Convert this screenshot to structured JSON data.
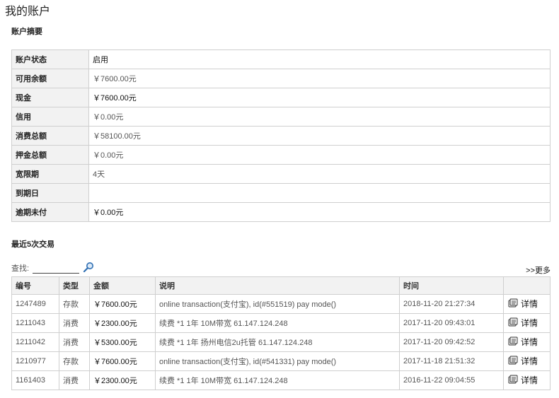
{
  "page_title": "我的账户",
  "summary": {
    "title": "账户摘要",
    "rows": [
      {
        "label": "账户状态",
        "value": "启用"
      },
      {
        "label": "可用余额",
        "value": "￥7600.00元"
      },
      {
        "label": "现金",
        "value": "￥7600.00元"
      },
      {
        "label": "信用",
        "value": "￥0.00元"
      },
      {
        "label": "消费总额",
        "value": "￥58100.00元"
      },
      {
        "label": "押金总额",
        "value": "￥0.00元"
      },
      {
        "label": "宽限期",
        "value": "4天"
      },
      {
        "label": "到期日",
        "value": ""
      },
      {
        "label": "逾期未付",
        "value": "￥0.00元"
      }
    ]
  },
  "transactions": {
    "title": "最近5次交易",
    "search_label": "查找:",
    "search_value": "",
    "more_label": ">>更多",
    "columns": [
      "编号",
      "类型",
      "金额",
      "说明",
      "时间",
      ""
    ],
    "rows": [
      {
        "id": "1247489",
        "type": "存款",
        "amount": "￥7600.00元",
        "description": "online transaction(支付宝), id(#551519) pay mode()",
        "time": "2018-11-20 21:27:34",
        "action": "详情"
      },
      {
        "id": "1211043",
        "type": "消费",
        "amount": "￥2300.00元",
        "description": "续费 *1 1年 10M带宽 61.147.124.248",
        "time": "2017-11-20 09:43:01",
        "action": "详情"
      },
      {
        "id": "1211042",
        "type": "消费",
        "amount": "￥5300.00元",
        "description": "续费 *1 1年 扬州电信2u托管 61.147.124.248",
        "time": "2017-11-20 09:42:52",
        "action": "详情"
      },
      {
        "id": "1210977",
        "type": "存款",
        "amount": "￥7600.00元",
        "description": "online transaction(支付宝), id(#541331) pay mode()",
        "time": "2017-11-18 21:51:32",
        "action": "详情"
      },
      {
        "id": "1161403",
        "type": "消费",
        "amount": "￥2300.00元",
        "description": "续费 *1 1年 10M带宽 61.147.124.248",
        "time": "2016-11-22 09:04:55",
        "action": "详情"
      }
    ]
  }
}
